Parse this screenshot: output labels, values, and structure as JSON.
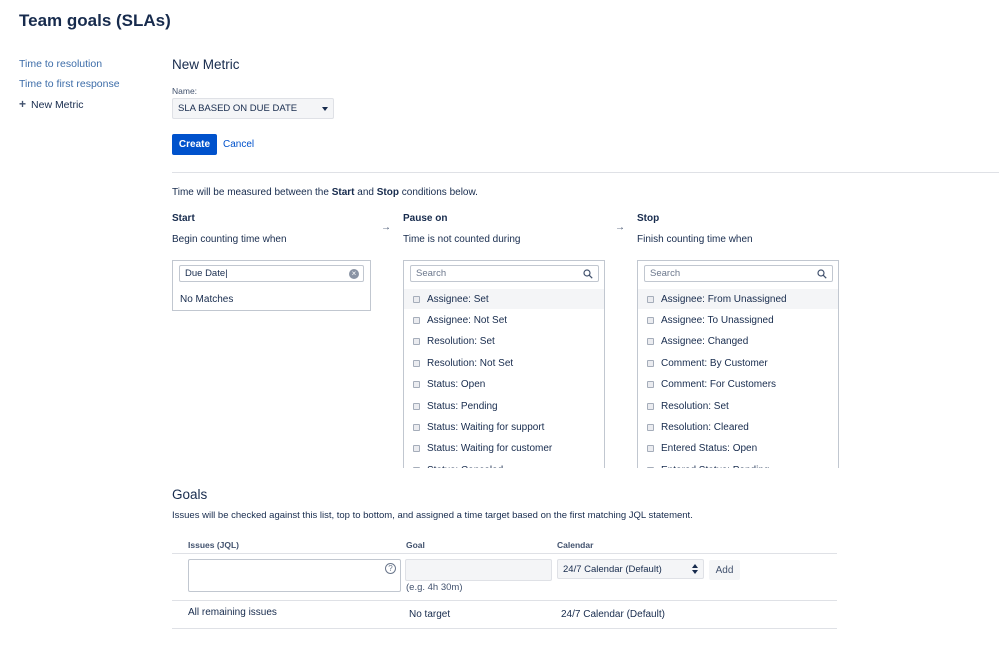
{
  "page": {
    "title": "Team goals (SLAs)"
  },
  "sidebar": {
    "items": [
      {
        "label": "Time to resolution"
      },
      {
        "label": "Time to first response"
      },
      {
        "label": "New Metric",
        "icon": "plus-icon"
      }
    ]
  },
  "metric": {
    "title": "New Metric",
    "name_label": "Name:",
    "name_value": "SLA BASED ON DUE DATE",
    "create_label": "Create",
    "cancel_label": "Cancel"
  },
  "conditions": {
    "intro_prefix": "Time will be measured between the ",
    "intro_start": "Start",
    "intro_and": " and ",
    "intro_stop": "Stop",
    "intro_suffix": " conditions below.",
    "arrow": "→",
    "start": {
      "heading": "Start",
      "subheading": "Begin counting time when",
      "search_value": "Due Date",
      "no_matches": "No Matches"
    },
    "pause": {
      "heading": "Pause on",
      "subheading": "Time is not counted during",
      "search_placeholder": "Search",
      "items": [
        "Assignee: Set",
        "Assignee: Not Set",
        "Resolution: Set",
        "Resolution: Not Set",
        "Status: Open",
        "Status: Pending",
        "Status: Waiting for support",
        "Status: Waiting for customer",
        "Status: Canceled"
      ]
    },
    "stop": {
      "heading": "Stop",
      "subheading": "Finish counting time when",
      "search_placeholder": "Search",
      "items": [
        "Assignee: From Unassigned",
        "Assignee: To Unassigned",
        "Assignee: Changed",
        "Comment: By Customer",
        "Comment: For Customers",
        "Resolution: Set",
        "Resolution: Cleared",
        "Entered Status: Open",
        "Entered Status: Pending"
      ]
    }
  },
  "goals": {
    "title": "Goals",
    "description": "Issues will be checked against this list, top to bottom, and assigned a time target based on the first matching JQL statement.",
    "columns": {
      "issues": "Issues (JQL)",
      "goal": "Goal",
      "calendar": "Calendar"
    },
    "new_row": {
      "jql_value": "",
      "goal_value": "",
      "goal_hint": "(e.g. 4h 30m)",
      "calendar_value": "24/7 Calendar (Default)",
      "add_label": "Add"
    },
    "remaining_row": {
      "issues": "All remaining issues",
      "goal": "No target",
      "calendar": "24/7 Calendar (Default)"
    }
  }
}
